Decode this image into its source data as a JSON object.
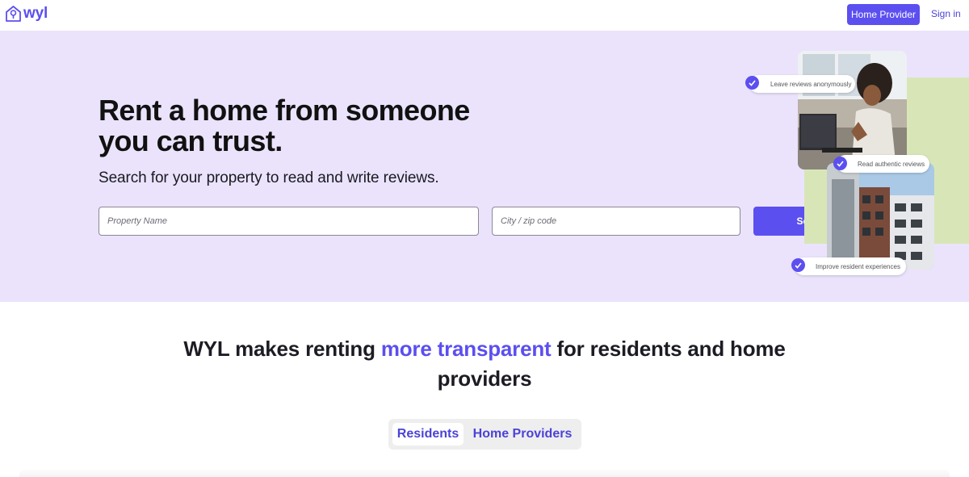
{
  "header": {
    "logo_text": "wyl",
    "home_provider_label": "Home Provider",
    "sign_in_label": "Sign in"
  },
  "hero": {
    "title": "Rent a home from someone you can trust.",
    "subtitle": "Search for your property to read and write reviews.",
    "property_placeholder": "Property Name",
    "city_placeholder": "City / zip code",
    "search_label": "Search",
    "badges": [
      "Leave reviews anonymously",
      "Read authentic reviews",
      "Improve resident experiences"
    ]
  },
  "section": {
    "title_before": "WYL makes renting ",
    "title_accent": "more transparent",
    "title_after": " for residents and home providers",
    "tabs": [
      "Residents",
      "Home Providers"
    ]
  },
  "colors": {
    "accent": "#5b4ff0",
    "hero_bg": "#ebe3fc",
    "green_block": "#d8e6b7"
  },
  "icons": [
    "house-pin-logo-icon",
    "check-icon"
  ]
}
